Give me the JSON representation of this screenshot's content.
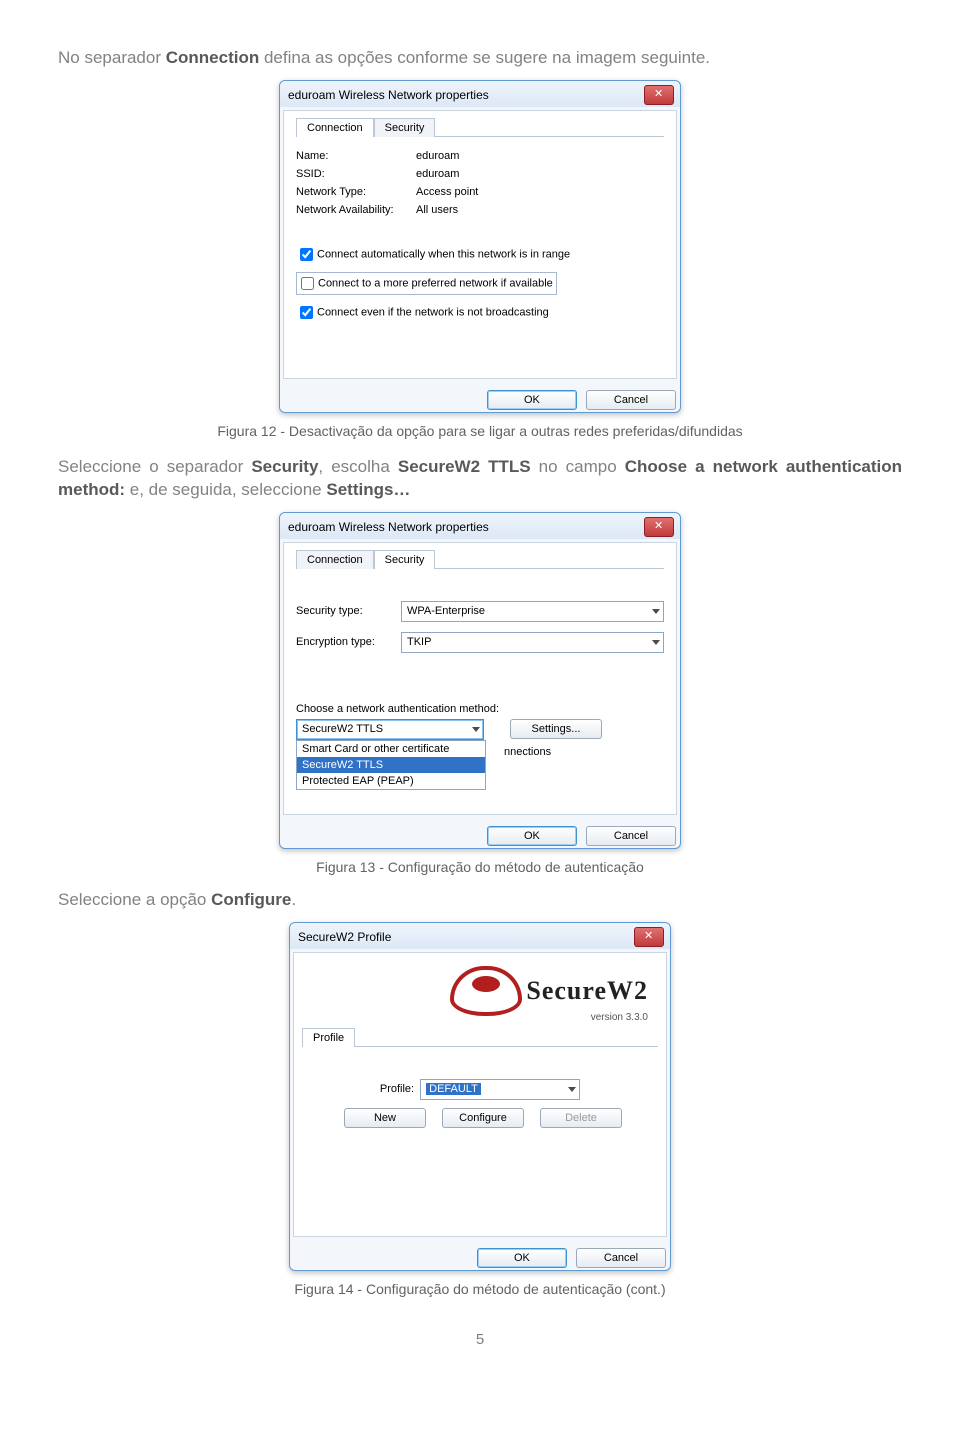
{
  "text": {
    "intro1_pre": "No separador ",
    "intro1_bold": "Connection",
    "intro1_post": " defina as opções conforme se sugere na imagem seguinte.",
    "fig12_caption": "Figura 12 - Desactivação da opção para se ligar a outras redes preferidas/difundidas",
    "intro2_p1a": "Seleccione o separador ",
    "intro2_p1b": "Security",
    "intro2_p1c": ", escolha ",
    "intro2_p1d": "SecureW2 TTLS",
    "intro2_p1e": " no campo ",
    "intro2_p1f": "Choose a network authentication method:",
    "intro2_p1g": " e, de seguida, seleccione ",
    "intro2_p1h": "Settings…",
    "intro3_a": "Seleccione a opção ",
    "intro3_b": "Configure",
    "intro3_c": ".",
    "fig13_caption": "Figura 13 - Configuração do método de autenticação",
    "fig14_caption": "Figura 14 - Configuração do método de autenticação (cont.)",
    "page_number": "5"
  },
  "win1": {
    "title": "eduroam Wireless Network properties",
    "tab_connection": "Connection",
    "tab_security": "Security",
    "name_label": "Name:",
    "name_value": "eduroam",
    "ssid_label": "SSID:",
    "ssid_value": "eduroam",
    "nettype_label": "Network Type:",
    "nettype_value": "Access point",
    "avail_label": "Network Availability:",
    "avail_value": "All users",
    "chk1": "Connect automatically when this network is in range",
    "chk2": "Connect to a more preferred network if available",
    "chk3": "Connect even if the network is not broadcasting",
    "ok": "OK",
    "cancel": "Cancel"
  },
  "win2": {
    "title": "eduroam Wireless Network properties",
    "tab_connection": "Connection",
    "tab_security": "Security",
    "sectype_label": "Security type:",
    "sectype_value": "WPA-Enterprise",
    "enctype_label": "Encryption type:",
    "enctype_value": "TKIP",
    "choose_label": "Choose a network authentication method:",
    "selected_method": "SecureW2 TTLS",
    "settings_btn": "Settings...",
    "opt_smart": "Smart Card or other certificate",
    "opt_sw2": "SecureW2 TTLS",
    "opt_peap": "Protected EAP (PEAP)",
    "trail": "nnections",
    "ok": "OK",
    "cancel": "Cancel"
  },
  "win3": {
    "title": "SecureW2 Profile",
    "logo_text": "SecureW2",
    "version": "version 3.3.0",
    "tab_profile": "Profile",
    "profile_label": "Profile:",
    "profile_value": "DEFAULT",
    "new_btn": "New",
    "configure_btn": "Configure",
    "delete_btn": "Delete",
    "ok": "OK",
    "cancel": "Cancel"
  }
}
